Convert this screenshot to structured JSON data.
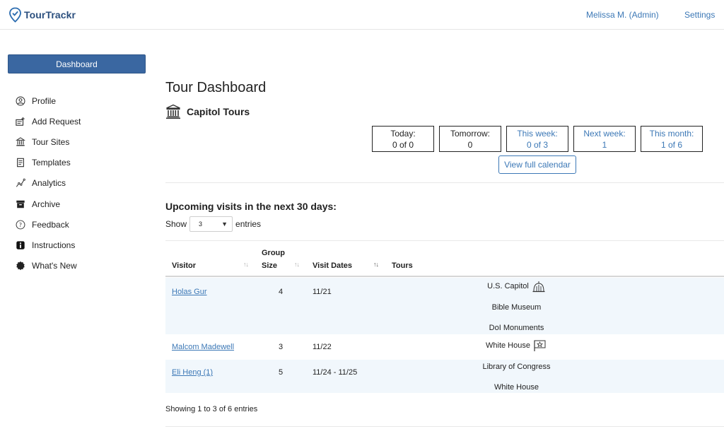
{
  "app": {
    "name": "TourTrackr"
  },
  "topnav": {
    "user": "Melissa M. (Admin)",
    "settings": "Settings"
  },
  "sidebar": {
    "dashboard": "Dashboard",
    "items": [
      {
        "label": "Profile",
        "icon": "user-circle-icon"
      },
      {
        "label": "Add Request",
        "icon": "add-request-icon"
      },
      {
        "label": "Tour Sites",
        "icon": "tour-sites-icon"
      },
      {
        "label": "Templates",
        "icon": "template-icon"
      },
      {
        "label": "Analytics",
        "icon": "analytics-icon"
      },
      {
        "label": "Archive",
        "icon": "archive-icon"
      },
      {
        "label": "Feedback",
        "icon": "help-circle-icon"
      },
      {
        "label": "Instructions",
        "icon": "info-icon"
      },
      {
        "label": "What's New",
        "icon": "badge-icon"
      }
    ]
  },
  "main": {
    "title": "Tour Dashboard",
    "section": "Capitol Tours",
    "stats": [
      {
        "label": "Today:",
        "value": "0 of 0"
      },
      {
        "label": "Tomorrow:",
        "value": "0"
      },
      {
        "label": "This week:",
        "value": "0 of 3"
      },
      {
        "label": "Next week:",
        "value": "1"
      },
      {
        "label": "This month:",
        "value": "1 of 6"
      }
    ],
    "calendar_button": "View full calendar",
    "upcoming_title": "Upcoming visits in the next 30 days:",
    "show_label": "Show",
    "show_value": "3",
    "entries_label": "entries",
    "table": {
      "headers": {
        "visitor": "Visitor",
        "group_line1": "Group",
        "group_line2": "Size",
        "visit_dates": "Visit Dates",
        "tours": "Tours"
      },
      "rows": [
        {
          "visitor": "Holas Gur",
          "group_size": "4",
          "dates": "11/21",
          "tours": [
            "U.S. Capitol",
            "Bible Museum",
            "DoI Monuments"
          ]
        },
        {
          "visitor": "Malcom Madewell",
          "group_size": "3",
          "dates": "11/22",
          "tours": [
            "White House"
          ]
        },
        {
          "visitor": "Eli Heng (1)",
          "group_size": "5",
          "dates": "11/24 - 11/25",
          "tours": [
            "Library of Congress",
            "White House"
          ]
        }
      ]
    },
    "footer_info": "Showing 1 to 3 of 6 entries"
  },
  "colors": {
    "brand": "#2b4f7e",
    "link": "#3c78b6",
    "primary_button": "#3a67a1",
    "row_alt": "#f1f7fc"
  }
}
